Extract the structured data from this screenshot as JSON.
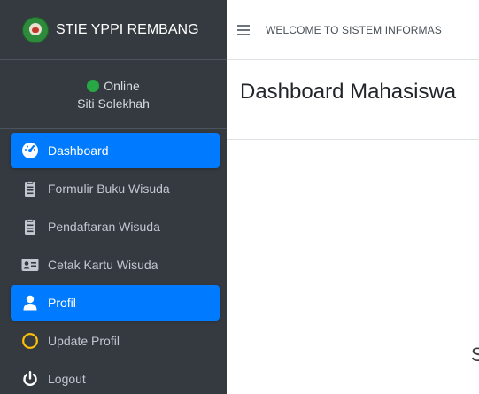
{
  "brand": {
    "name": "STIE YPPI REMBANG"
  },
  "user_panel": {
    "status": "Online",
    "name": "Siti Solekhah"
  },
  "nav": [
    {
      "label": "Dashboard",
      "icon": "tachometer-icon",
      "active": true
    },
    {
      "label": "Formulir Buku Wisuda",
      "icon": "clipboard-list-icon",
      "active": false
    },
    {
      "label": "Pendaftaran Wisuda",
      "icon": "clipboard-list-icon",
      "active": false
    },
    {
      "label": "Cetak Kartu Wisuda",
      "icon": "id-card-icon",
      "active": false
    },
    {
      "label": "Profil",
      "icon": "user-icon",
      "active": true
    },
    {
      "label": "Update Profil",
      "icon": "circle-outline-icon",
      "active": false
    },
    {
      "label": "Logout",
      "icon": "power-off-icon",
      "active": false
    }
  ],
  "topbar": {
    "welcome_text": "WELCOME TO SISTEM INFORMAS"
  },
  "content": {
    "title": "Dashboard Mahasiswa",
    "partial_text": "S"
  },
  "colors": {
    "sidebar_bg": "#343a40",
    "active_bg": "#007bff",
    "online_dot": "#28a745",
    "update_ring": "#ffc107"
  }
}
